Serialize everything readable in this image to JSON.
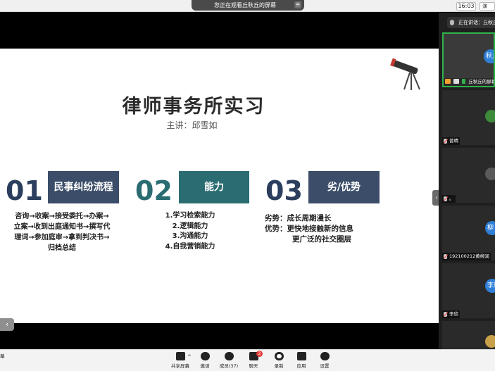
{
  "top_bar": {
    "viewing_label": "您正在观看丘秋丘的屏幕",
    "clock": "16:03",
    "right_partial": "演"
  },
  "slide": {
    "title": "律师事务所实习",
    "subtitle": "主讲：邱雪如",
    "sections": [
      {
        "number": "01",
        "heading": "民事纠纷流程",
        "lines": [
          "咨询→收案→接受委托→办案→",
          "立案→收到出庭通知书→撰写代",
          "理词→参加庭审→拿到判决书→",
          "归档总结"
        ]
      },
      {
        "number": "02",
        "heading": "能力",
        "lines": [
          "1.学习检索能力",
          "2.逻辑能力",
          "3.沟通能力",
          "4.自我营销能力"
        ]
      },
      {
        "number": "03",
        "heading": "劣/优势",
        "lines": [
          "劣势：成长周期漫长",
          "优势：更快地接触新的信息",
          "更广泛的社交圈层"
        ]
      }
    ],
    "prev_glyph": "‹",
    "collapse_glyph": "›"
  },
  "participants": {
    "speaking_label": "正在讲话：丘秋丘；",
    "tiles": [
      {
        "avatar_text": "秋丘",
        "name": "丘秋丘的屏幕",
        "active": true
      },
      {
        "avatar_text": "",
        "name": "曾晴",
        "active": false
      },
      {
        "avatar_text": "",
        "name": "。",
        "active": false
      },
      {
        "avatar_text": "柳",
        "name": "192100212黄柳润",
        "active": false
      },
      {
        "avatar_text": "李欣",
        "name": "李欣",
        "active": false
      },
      {
        "avatar_text": "",
        "name": "",
        "active": false
      }
    ]
  },
  "toolbar": {
    "left_partial": "幕",
    "share_label": "共享屏幕",
    "share_caret": "^",
    "invite_label": "邀请",
    "members_label": "成员(37)",
    "chat_label": "聊天",
    "chat_badge": "2",
    "record_label": "录制",
    "apps_label": "应用",
    "settings_label": "设置"
  },
  "colors": {
    "navy": "#3b4d68",
    "teal": "#2b6c72",
    "active_border": "#2fb24a",
    "avatar_blue": "#2f7fd8",
    "badge_red": "#e53935"
  }
}
